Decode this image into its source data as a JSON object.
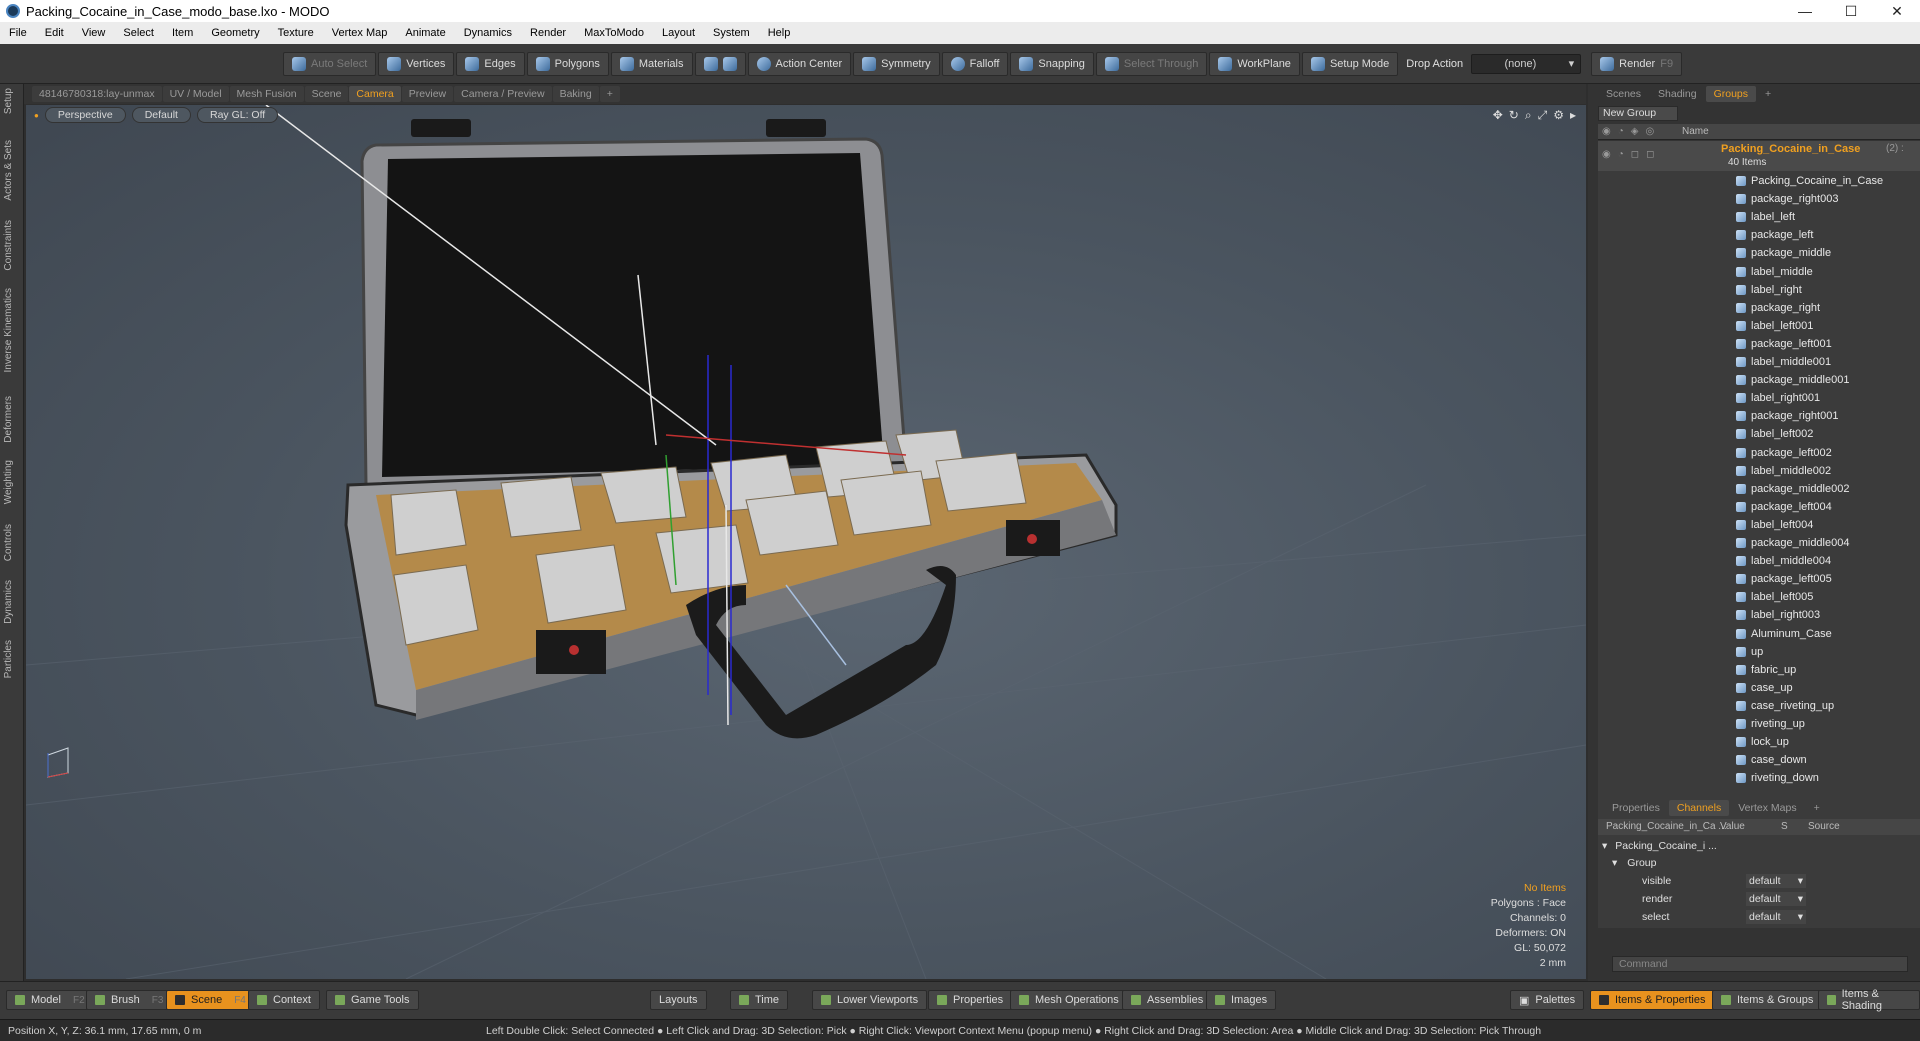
{
  "window": {
    "title": "Packing_Cocaine_in_Case_modo_base.lxo - MODO",
    "min": "—",
    "max": "☐",
    "close": "✕"
  },
  "menu": [
    "File",
    "Edit",
    "View",
    "Select",
    "Item",
    "Geometry",
    "Texture",
    "Vertex Map",
    "Animate",
    "Dynamics",
    "Render",
    "MaxToModo",
    "Layout",
    "System",
    "Help"
  ],
  "toolbar": {
    "auto_select": "Auto Select",
    "vertices": "Vertices",
    "edges": "Edges",
    "polygons": "Polygons",
    "materials": "Materials",
    "action_center": "Action Center",
    "symmetry": "Symmetry",
    "falloff": "Falloff",
    "snapping": "Snapping",
    "select_through": "Select Through",
    "workplane": "WorkPlane",
    "setup_mode": "Setup Mode",
    "drop_action": "Drop Action",
    "drop_value": "(none)",
    "render": "Render",
    "render_key": "F9"
  },
  "left_tabs": [
    "Setup",
    "Actors & Sets",
    "Constraints",
    "Inverse Kinematics",
    "Deformers",
    "Weighting",
    "Controls",
    "Dynamics",
    "Particles"
  ],
  "viewport_tabs": [
    "48146780318:lay-unmax",
    "UV / Model",
    "Mesh Fusion",
    "Scene",
    "Camera",
    "Preview",
    "Camera / Preview",
    "Baking",
    "+"
  ],
  "viewport": {
    "perspective": "Perspective",
    "default": "Default",
    "raygl": "Ray GL: Off",
    "stats": {
      "no_items": "No Items",
      "polygons": "Polygons : Face",
      "channels": "Channels: 0",
      "deformers": "Deformers: ON",
      "gl": "GL: 50,072",
      "scale": "2 mm"
    }
  },
  "right_tabs": [
    "Scenes",
    "Shading",
    "Groups",
    "+"
  ],
  "groups": {
    "new_group": "New Group",
    "col_name": "Name",
    "root_name": "Packing_Cocaine_in_Case",
    "root_count": "(2) :",
    "root_items": "40 Items",
    "items": [
      "Packing_Cocaine_in_Case",
      "package_right003",
      "label_left",
      "package_left",
      "package_middle",
      "label_middle",
      "label_right",
      "package_right",
      "label_left001",
      "package_left001",
      "label_middle001",
      "package_middle001",
      "label_right001",
      "package_right001",
      "label_left002",
      "package_left002",
      "label_middle002",
      "package_middle002",
      "package_left004",
      "label_left004",
      "package_middle004",
      "label_middle004",
      "package_left005",
      "label_left005",
      "label_right003",
      "Aluminum_Case",
      "up",
      "fabric_up",
      "case_up",
      "case_riveting_up",
      "riveting_up",
      "lock_up",
      "case_down",
      "riveting_down"
    ]
  },
  "props_tabs": [
    "Properties",
    "Channels",
    "Vertex Maps",
    "+"
  ],
  "channels": {
    "head_name": "Packing_Cocaine_in_Ca ...",
    "head_value": "Value",
    "head_s": "S",
    "head_source": "Source",
    "row_root": "Packing_Cocaine_i ...",
    "row_group": "Group",
    "rows": [
      {
        "name": "visible",
        "value": "default"
      },
      {
        "name": "render",
        "value": "default"
      },
      {
        "name": "select",
        "value": "default"
      }
    ]
  },
  "command_placeholder": "Command",
  "bottom": {
    "model": "Model",
    "model_key": "F2",
    "brush": "Brush",
    "brush_key": "F3",
    "scene": "Scene",
    "scene_key": "F4",
    "context": "Context",
    "game_tools": "Game Tools",
    "layouts": "Layouts",
    "time": "Time",
    "lower_viewports": "Lower Viewports",
    "properties": "Properties",
    "mesh_operations": "Mesh Operations",
    "assemblies": "Assemblies",
    "images": "Images",
    "palettes": "Palettes",
    "items_properties": "Items & Properties",
    "items_groups": "Items & Groups",
    "items_shading": "Items & Shading"
  },
  "status": {
    "position": "Position X, Y, Z:   36.1 mm, 17.65 mm, 0 m",
    "hint": "Left Double Click: Select Connected ● Left Click and Drag: 3D Selection: Pick ● Right Click: Viewport Context Menu (popup menu) ● Right Click and Drag: 3D Selection: Area ● Middle Click and Drag: 3D Selection: Pick Through"
  }
}
